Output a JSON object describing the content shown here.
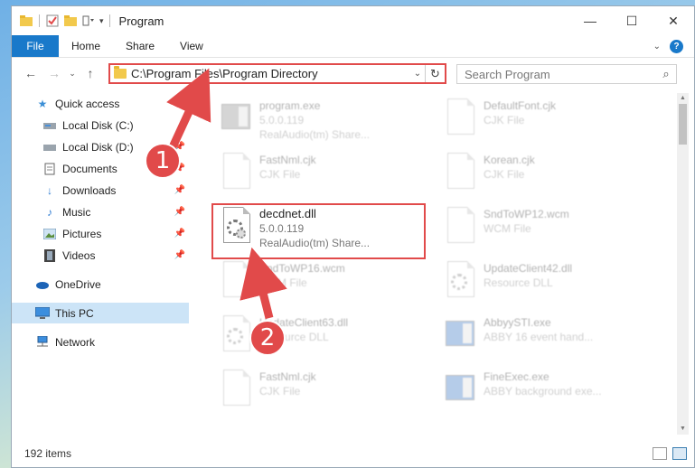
{
  "window": {
    "title": "Program",
    "controls": {
      "minimize": "—",
      "maximize": "☐",
      "close": "✕"
    }
  },
  "ribbon": {
    "file": "File",
    "tabs": [
      "Home",
      "Share",
      "View"
    ]
  },
  "address_bar": {
    "path": "C:\\Program Files\\Program Directory",
    "search_placeholder": "Search Program"
  },
  "sidebar": {
    "items": [
      {
        "label": "Quick access",
        "icon": "star-icon",
        "pinned": false
      },
      {
        "label": "Local Disk (C:)",
        "icon": "drive-icon",
        "pinned": true
      },
      {
        "label": "Local Disk (D:)",
        "icon": "drive-icon",
        "pinned": true
      },
      {
        "label": "Documents",
        "icon": "documents-icon",
        "pinned": true
      },
      {
        "label": "Downloads",
        "icon": "download-icon",
        "pinned": true
      },
      {
        "label": "Music",
        "icon": "music-icon",
        "pinned": true
      },
      {
        "label": "Pictures",
        "icon": "pictures-icon",
        "pinned": true
      },
      {
        "label": "Videos",
        "icon": "videos-icon",
        "pinned": true
      },
      {
        "label": "OneDrive",
        "icon": "cloud-icon",
        "pinned": false
      },
      {
        "label": "This PC",
        "icon": "computer-icon",
        "pinned": false
      },
      {
        "label": "Network",
        "icon": "network-icon",
        "pinned": false
      }
    ]
  },
  "files": [
    {
      "name": "program.exe",
      "line2": "5.0.0.119",
      "line3": "RealAudio(tm) Share...",
      "icon": "app-icon"
    },
    {
      "name": "DefaultFont.cjk",
      "line2": "CJK File",
      "line3": "",
      "icon": "document-icon"
    },
    {
      "name": "FastNml.cjk",
      "line2": "CJK File",
      "line3": "",
      "icon": "document-icon"
    },
    {
      "name": "Korean.cjk",
      "line2": "CJK File",
      "line3": "",
      "icon": "document-icon"
    },
    {
      "name": "decdnet.dll",
      "line2": "5.0.0.119",
      "line3": "RealAudio(tm) Share...",
      "icon": "dll-gear-icon"
    },
    {
      "name": "SndToWP12.wcm",
      "line2": "WCM File",
      "line3": "",
      "icon": "document-icon"
    },
    {
      "name": "SndToWP16.wcm",
      "line2": "WCM File",
      "line3": "",
      "icon": "document-icon"
    },
    {
      "name": "UpdateClient42.dll",
      "line2": "Resource DLL",
      "line3": "",
      "icon": "dll-gear-icon"
    },
    {
      "name": "UpdateClient63.dll",
      "line2": "Resource DLL",
      "line3": "",
      "icon": "dll-gear-icon"
    },
    {
      "name": "AbbyySTI.exe",
      "line2": "ABBY 16 event hand...",
      "line3": "",
      "icon": "app-icon"
    },
    {
      "name": "FastNml.cjk",
      "line2": "CJK File",
      "line3": "",
      "icon": "document-icon"
    },
    {
      "name": "FineExec.exe",
      "line2": "ABBY background exe...",
      "line3": "",
      "icon": "app-icon"
    }
  ],
  "status": {
    "items": "192 items"
  },
  "callouts": [
    "1",
    "2"
  ],
  "colors": {
    "accent": "#1979ca",
    "highlight": "#e14a4a",
    "selected": "#cce4f7"
  }
}
